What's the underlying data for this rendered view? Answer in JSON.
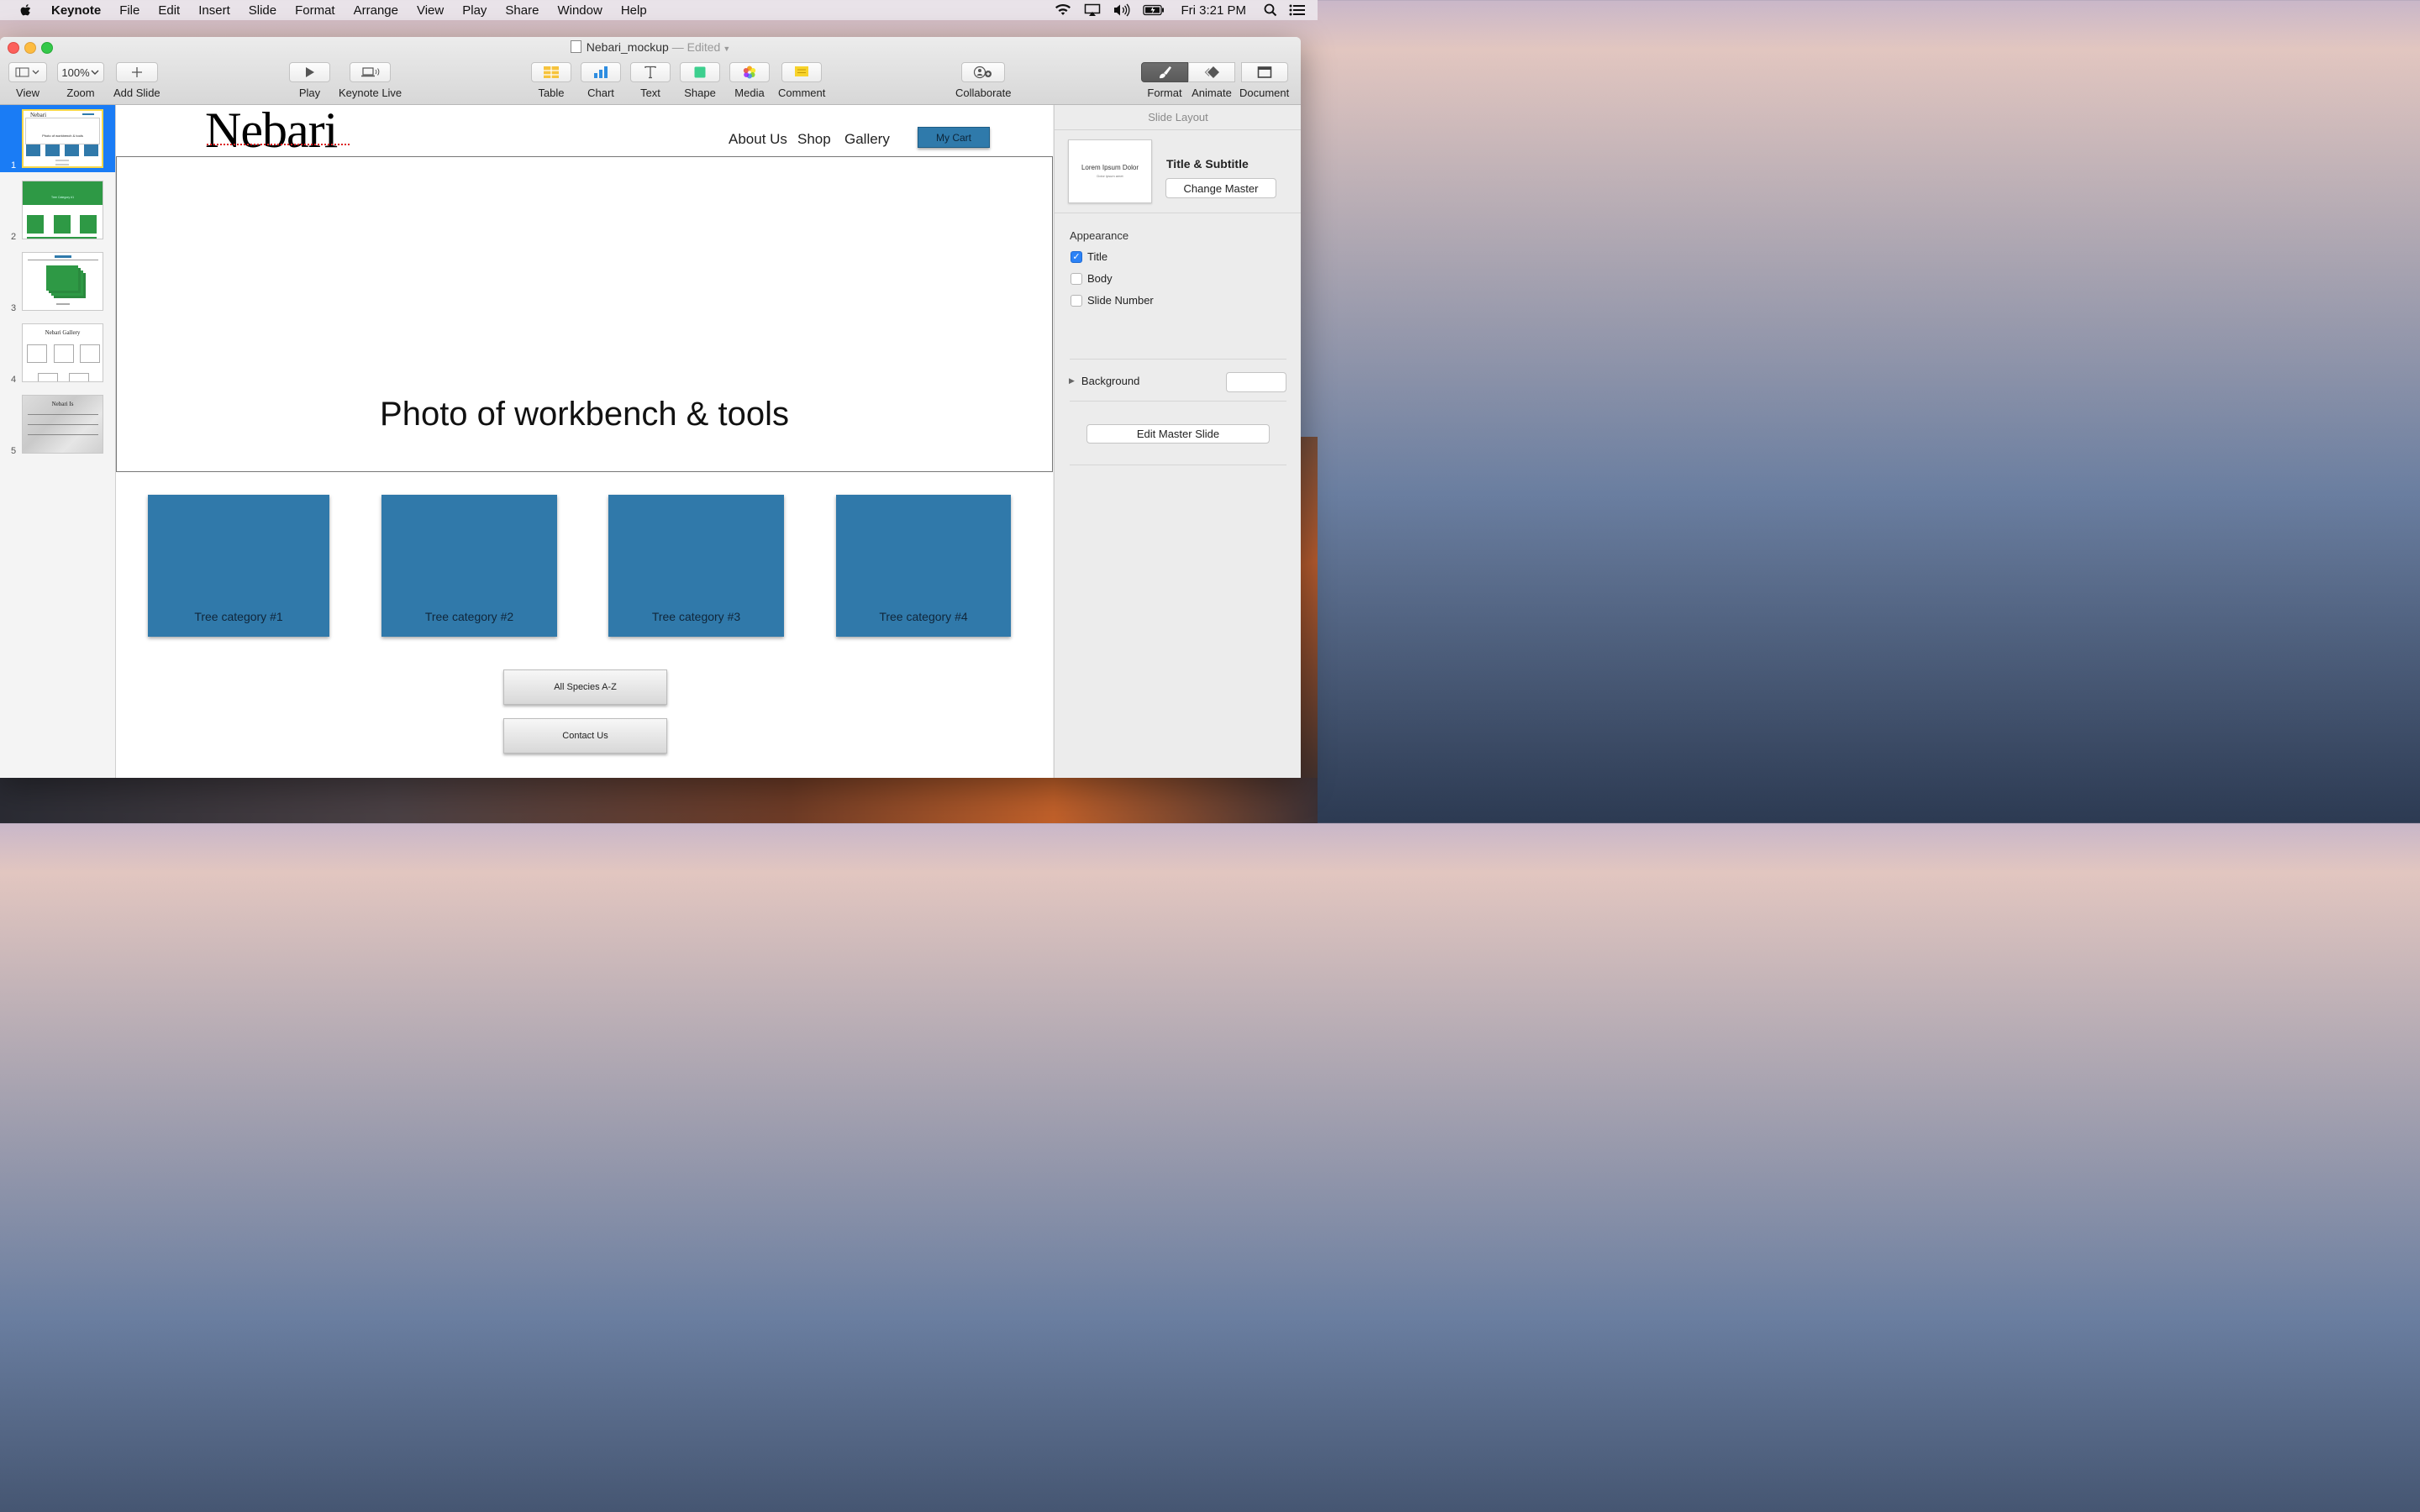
{
  "menubar": {
    "app": "Keynote",
    "items": [
      "File",
      "Edit",
      "Insert",
      "Slide",
      "Format",
      "Arrange",
      "View",
      "Play",
      "Share",
      "Window",
      "Help"
    ],
    "clock": "Fri 3:21 PM"
  },
  "window": {
    "title": "Nebari_mockup",
    "status": "— Edited"
  },
  "toolbar": {
    "view": "View",
    "zoom": "Zoom",
    "zoom_value": "100%",
    "add_slide": "Add Slide",
    "play": "Play",
    "keynote_live": "Keynote Live",
    "table": "Table",
    "chart": "Chart",
    "text": "Text",
    "shape": "Shape",
    "media": "Media",
    "comment": "Comment",
    "collaborate": "Collaborate",
    "format": "Format",
    "animate": "Animate",
    "document": "Document"
  },
  "navigator": {
    "slides": [
      {
        "num": "1",
        "title": "Nebari",
        "caption": "Photo of workbench & tools"
      },
      {
        "num": "2",
        "title": "Tree Category #1"
      },
      {
        "num": "3",
        "title": ""
      },
      {
        "num": "4",
        "title": "Nebari Gallery"
      },
      {
        "num": "5",
        "title": "Nebari Is"
      }
    ]
  },
  "slide": {
    "logo": "Nebari",
    "nav": [
      "About Us",
      "Shop",
      "Gallery"
    ],
    "cart": "My Cart",
    "photo_placeholder": "Photo of workbench & tools",
    "categories": [
      "Tree category #1",
      "Tree category #2",
      "Tree category #3",
      "Tree category #4"
    ],
    "all_species": "All Species A-Z",
    "contact": "Contact Us",
    "colors": {
      "category_fill": "#3079aa",
      "cart_fill": "#2f7aab"
    }
  },
  "inspector": {
    "header": "Slide Layout",
    "master_thumb_title": "Lorem Ipsum Dolor",
    "master_thumb_subtitle": "Dolor ipsum amet",
    "master_name": "Title & Subtitle",
    "change_master": "Change Master",
    "appearance": "Appearance",
    "options": [
      {
        "label": "Title",
        "checked": true
      },
      {
        "label": "Body",
        "checked": false
      },
      {
        "label": "Slide Number",
        "checked": false
      }
    ],
    "background": "Background",
    "edit_master": "Edit Master Slide"
  }
}
